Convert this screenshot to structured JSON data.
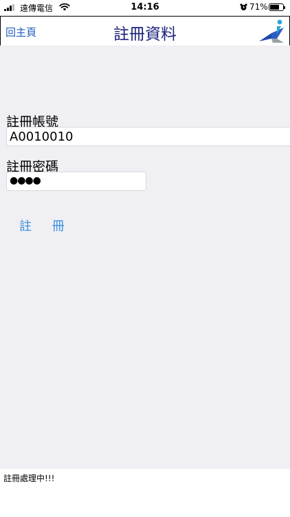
{
  "status_bar": {
    "carrier": "遠傳電信",
    "time": "14:16",
    "battery": "71%",
    "battery_level": 0.71
  },
  "header": {
    "home_label": "回主頁",
    "title": "註冊資料",
    "logo_icon": "app-logo-icon"
  },
  "form": {
    "account_label": "註冊帳號",
    "account_value": "A0010010",
    "password_label": "註冊密碼",
    "password_mask": "●●●●",
    "register_label": "註 冊"
  },
  "footer": {
    "status_message": "註冊處理中!!!"
  },
  "colors": {
    "link_blue": "#1f5bbf",
    "title_navy": "#1a1f7a",
    "button_blue": "#3a8fe0",
    "background_gray": "#efeff4"
  }
}
